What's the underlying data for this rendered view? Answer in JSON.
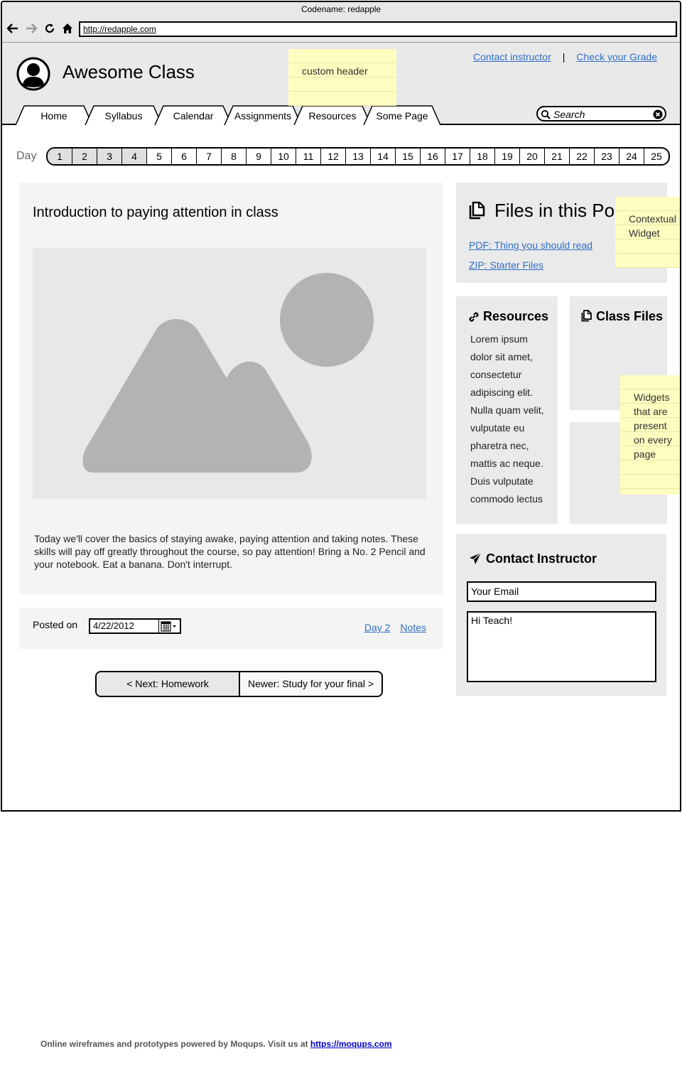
{
  "window": {
    "title": "Codename: redapple",
    "url": "http://redapple.com"
  },
  "header": {
    "app_title": "Awesome Class",
    "links": {
      "contact": "Contact instructor",
      "separator": "|",
      "grade": "Check your Grade"
    },
    "tabs": [
      "Home",
      "Syllabus",
      "Calendar",
      "Assignments",
      "Resources",
      "Some Page"
    ],
    "search_placeholder": "Search"
  },
  "notes": {
    "header": "custom header",
    "contextual": [
      "Contextual",
      "Widget"
    ],
    "widgets": [
      "Widgets",
      "that are",
      "present",
      "on every",
      "page"
    ]
  },
  "days": {
    "label": "Day",
    "items": [
      "1",
      "2",
      "3",
      "4",
      "5",
      "6",
      "7",
      "8",
      "9",
      "10",
      "11",
      "12",
      "13",
      "14",
      "15",
      "16",
      "17",
      "18",
      "19",
      "20",
      "21",
      "22",
      "23",
      "24",
      "25"
    ],
    "shaded": [
      "1",
      "2",
      "3",
      "4"
    ]
  },
  "post": {
    "title": "Introduction to paying attention in class",
    "body": "Today we'll cover the basics of staying awake, paying attention and taking notes. These skills will pay off greatly throughout the course, so pay attention! Bring a No. 2 Pencil and your notebook. Eat a banana. Don't interrupt.",
    "posted_label": "Posted on",
    "date": "4/22/2012",
    "links": {
      "day": "Day 2",
      "notes": "Notes"
    }
  },
  "pager": {
    "prev": "< Next: Homework",
    "next": "Newer: Study for your final >"
  },
  "files_widget": {
    "title": "Files in this Post",
    "links": [
      "PDF: Thing you should read",
      "ZIP: Starter Files"
    ]
  },
  "resources_widget": {
    "title": "Resources",
    "text": "Lorem ipsum dolor sit amet, consectetur adipiscing elit. Nulla quam velit, vulputate eu pharetra nec, mattis ac neque. Duis vulputate commodo lectus"
  },
  "class_files_widget": {
    "title": "Class Files"
  },
  "contact_widget": {
    "title": "Contact Instructor",
    "email_value": "Your Email",
    "message_value": "Hi Teach!"
  },
  "footer": {
    "text": "Online wireframes and prototypes powered by Moqups. Visit us at ",
    "link": "https://moqups.com"
  }
}
